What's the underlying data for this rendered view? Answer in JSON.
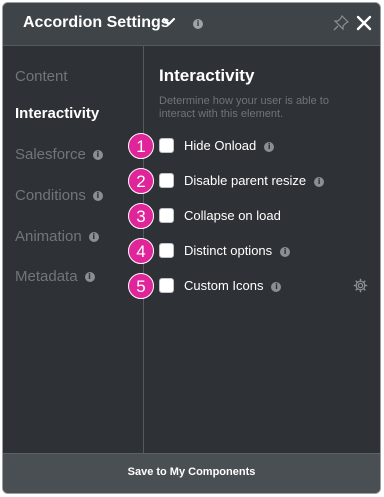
{
  "header": {
    "title": "Accordion Settings",
    "info_glyph": "i"
  },
  "sidebar": {
    "items": [
      {
        "label": "Content",
        "active": false,
        "has_info": false
      },
      {
        "label": "Interactivity",
        "active": true,
        "has_info": false
      },
      {
        "label": "Salesforce",
        "active": false,
        "has_info": true
      },
      {
        "label": "Conditions",
        "active": false,
        "has_info": true
      },
      {
        "label": "Animation",
        "active": false,
        "has_info": true
      },
      {
        "label": "Metadata",
        "active": false,
        "has_info": true
      }
    ]
  },
  "section": {
    "title": "Interactivity",
    "description": "Determine how your user is able to interact with this element."
  },
  "options": [
    {
      "badge": "1",
      "label": "Hide Onload",
      "checked": false,
      "has_gear": false
    },
    {
      "badge": "2",
      "label": "Disable parent resize",
      "checked": false,
      "has_gear": false
    },
    {
      "badge": "3",
      "label": "Collapse on load",
      "checked": false,
      "has_gear": false
    },
    {
      "badge": "4",
      "label": "Distinct options",
      "checked": false,
      "has_gear": false
    },
    {
      "badge": "5",
      "label": "Custom Icons",
      "checked": false,
      "has_gear": true
    }
  ],
  "footer": {
    "save_label": "Save to My Components"
  },
  "colors": {
    "panel_bg": "#2e3236",
    "header_bg": "#3f4449",
    "badge": "#e0249a",
    "footer_bg": "#4a4f54"
  }
}
